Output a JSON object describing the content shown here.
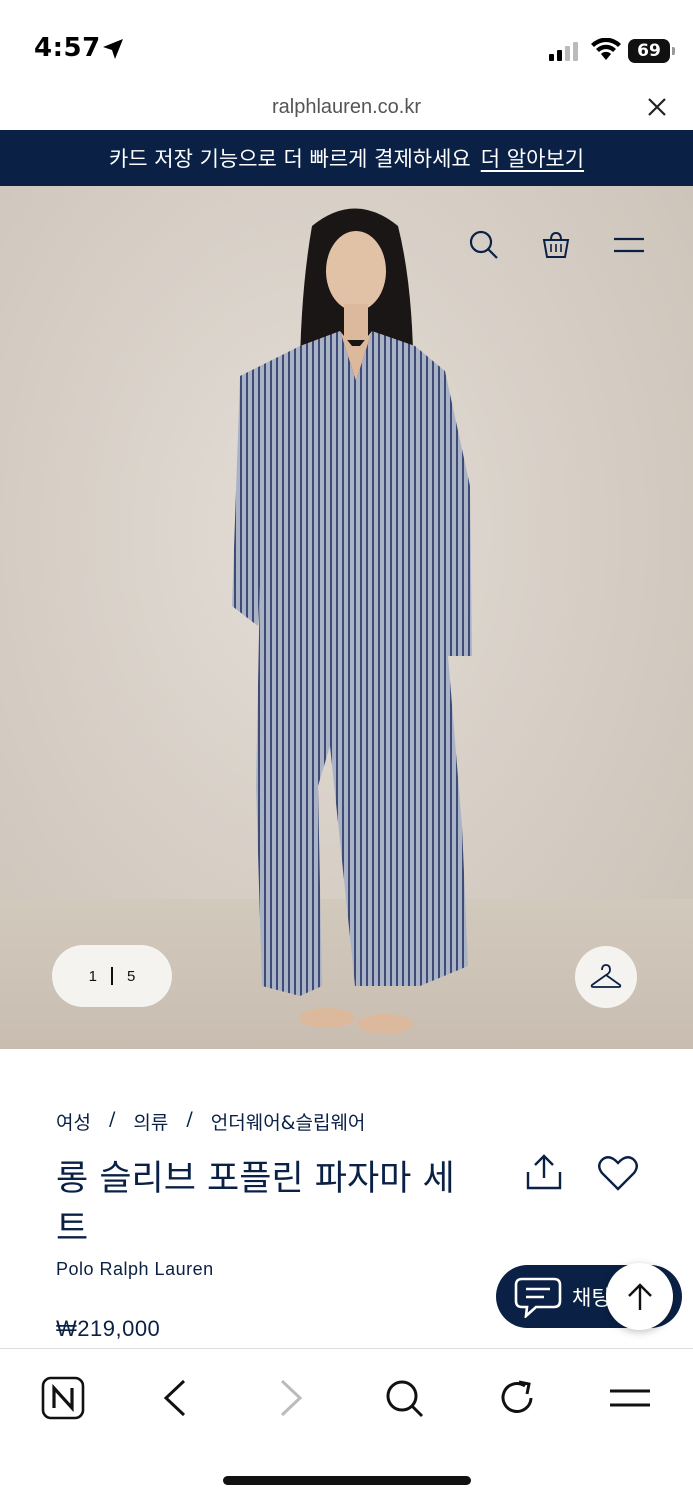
{
  "status_bar": {
    "time": "4:57",
    "battery": "69"
  },
  "browser": {
    "url": "ralphlauren.co.kr"
  },
  "promo": {
    "text": "카드 저장 기능으로 더 빠르게 결제하세요",
    "link": "더 알아보기"
  },
  "gallery": {
    "current": "1",
    "total": "5"
  },
  "breadcrumb": [
    "여성",
    "/",
    "의류",
    "/",
    "언더웨어&슬립웨어"
  ],
  "product": {
    "title": "롱 슬리브 포플린 파자마 세트",
    "brand": "Polo Ralph Lauren",
    "price": "₩219,000"
  },
  "chat": {
    "label": "채팅"
  },
  "colors": {
    "navy": "#0a2145",
    "hero_bg": "#d8d0c7"
  }
}
